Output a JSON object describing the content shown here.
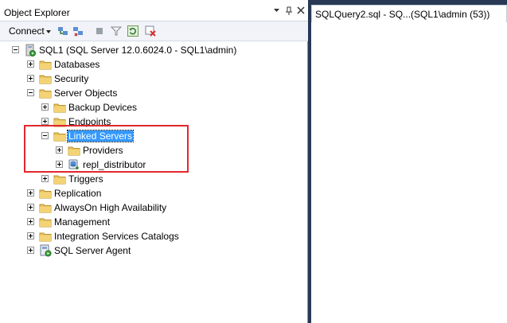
{
  "object_explorer": {
    "title": "Object Explorer",
    "titlebar_buttons": [
      "pin-dropdown",
      "pin",
      "close"
    ],
    "toolbar": {
      "connect_label": "Connect",
      "icons": [
        "connect-icon",
        "disconnect-icon",
        "stop-icon",
        "filter-icon",
        "refresh-icon",
        "activity-monitor-icon"
      ]
    },
    "tree": {
      "server": "SQL1 (SQL Server 12.0.6024.0 - SQL1\\admin)",
      "databases": "Databases",
      "security": "Security",
      "server_objects": "Server Objects",
      "backup_devices": "Backup Devices",
      "endpoints": "Endpoints",
      "linked_servers": "Linked Servers",
      "providers": "Providers",
      "repl_distributor": "repl_distributor",
      "triggers": "Triggers",
      "replication": "Replication",
      "alwayson": "AlwaysOn High Availability",
      "management": "Management",
      "integration_services": "Integration Services Catalogs",
      "sql_server_agent": "SQL Server Agent"
    }
  },
  "editor": {
    "tab_label": "SQLQuery2.sql - SQ...(SQL1\\admin (53))"
  },
  "colors": {
    "selection": "#3399ff",
    "highlight_box": "#e3262d",
    "folder": "#e8c15a",
    "background": "#293955"
  }
}
